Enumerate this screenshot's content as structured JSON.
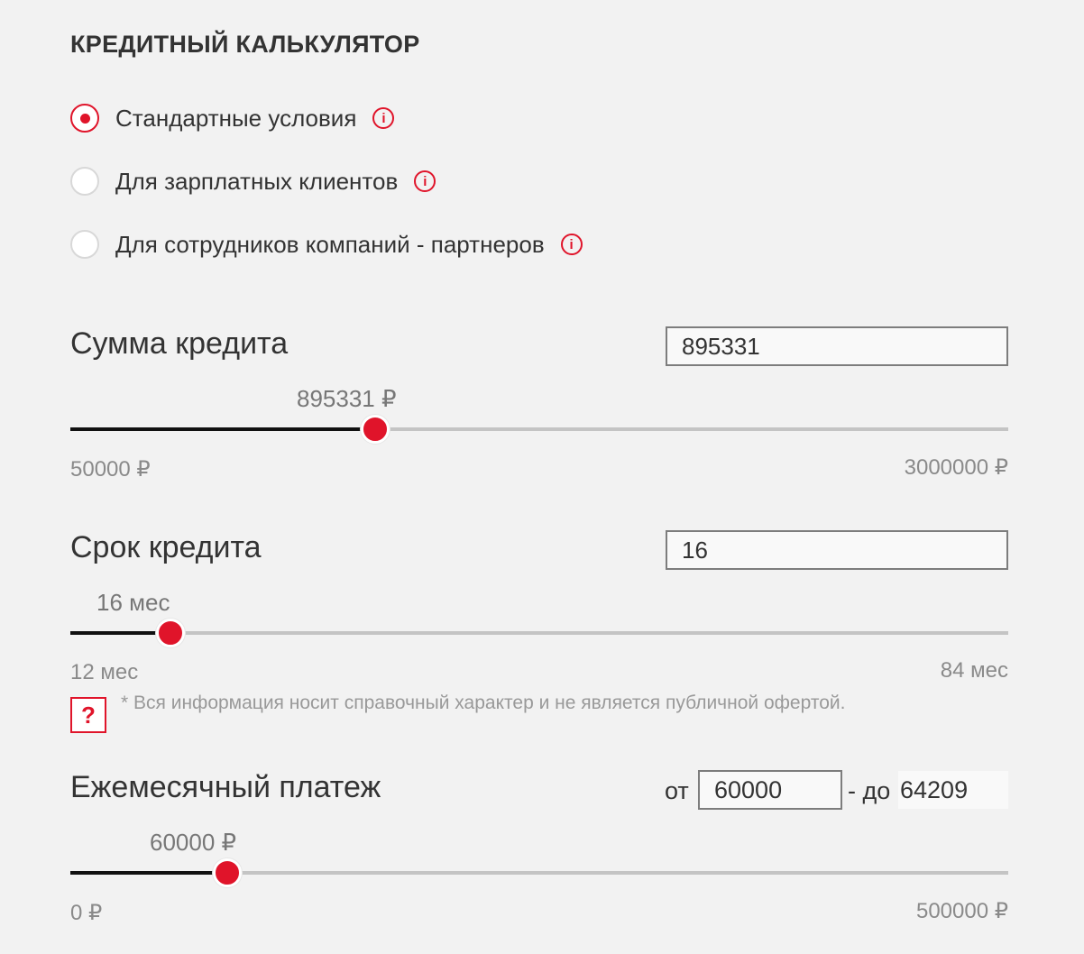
{
  "title": "КРЕДИТНЫЙ КАЛЬКУЛЯТОР",
  "options": [
    {
      "label": "Стандартные условия",
      "selected": true
    },
    {
      "label": "Для зарплатных клиентов",
      "selected": false
    },
    {
      "label": "Для сотрудников компаний - партнеров",
      "selected": false
    }
  ],
  "info_icon_glyph": "i",
  "amount": {
    "label": "Сумма кредита",
    "input_value": "895331",
    "slider_value": 895331,
    "bubble": "895331 ₽",
    "min_label": "50000 ₽",
    "max_label": "3000000 ₽",
    "min": 50000,
    "max": 3000000
  },
  "term": {
    "label": "Срок кредита",
    "input_value": "16",
    "slider_value": 16,
    "bubble": "16 мес",
    "min_label": "12 мес",
    "max_label": "84 мес",
    "min": 12,
    "max": 84
  },
  "help_glyph": "?",
  "disclaimer": "* Вся информация носит справочный характер и не является публичной офертой.",
  "payment": {
    "label": "Ежемесячный платеж",
    "from_prefix": "от",
    "from_value": "60000",
    "to_prefix": "- до",
    "to_value": "64209",
    "slider_value": 60000,
    "bubble": "60000 ₽",
    "min_label": "0 ₽",
    "max_label": "500000 ₽",
    "min": 0,
    "max": 500000
  },
  "colors": {
    "accent": "#e0142a",
    "background": "#f2f2f2"
  }
}
